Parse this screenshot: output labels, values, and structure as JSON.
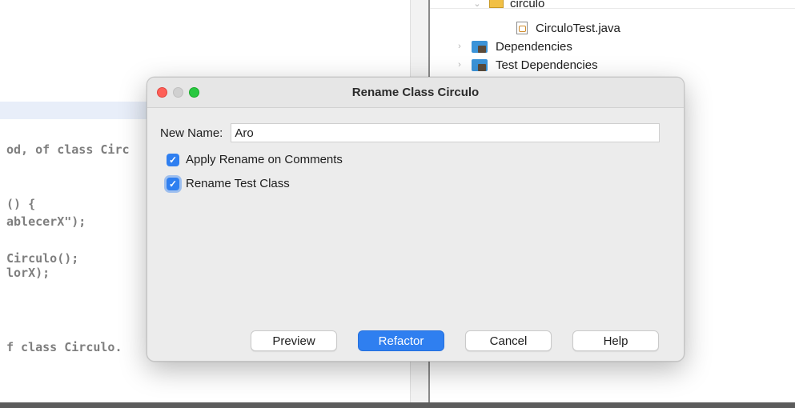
{
  "editor": {
    "lines": [
      {
        "parts": [
          "od, of class Circ"
        ]
      },
      {
        "parts": [
          "() {"
        ]
      },
      {
        "parts": [
          "ablecerX\");"
        ]
      },
      {
        "parts": [
          "Circulo();"
        ]
      },
      {
        "parts": [
          "lorX);"
        ]
      },
      {
        "parts": [
          "f class Circulo."
        ]
      }
    ]
  },
  "project_tree": {
    "items": [
      {
        "label": "circulo"
      },
      {
        "label": "CirculoTest.java"
      },
      {
        "label": "Dependencies"
      },
      {
        "label": "Test Dependencies"
      }
    ]
  },
  "dialog": {
    "title": "Rename Class Circulo",
    "new_name_label": "New Name:",
    "new_name_value": "Aro",
    "options": [
      {
        "label": "Apply Rename on Comments",
        "checked": true
      },
      {
        "label": "Rename Test Class",
        "checked": true
      }
    ],
    "buttons": {
      "preview": "Preview",
      "refactor": "Refactor",
      "cancel": "Cancel",
      "help": "Help"
    }
  },
  "colors": {
    "accent": "#2f7ff0",
    "traffic_close": "#fe5f57",
    "traffic_zoom": "#28c840"
  }
}
